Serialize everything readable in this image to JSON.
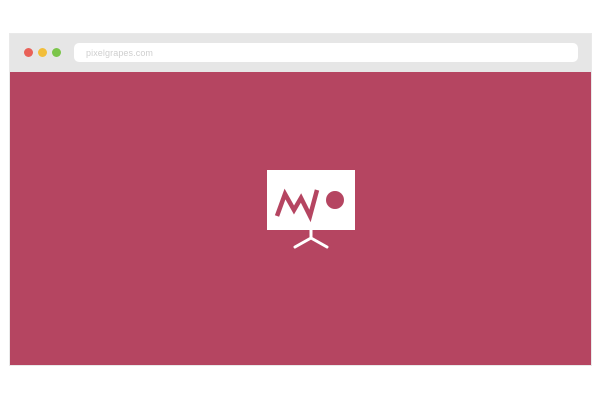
{
  "window": {
    "traffic_lights": [
      {
        "name": "close",
        "color": "#e96158"
      },
      {
        "name": "minimize",
        "color": "#f2be3a"
      },
      {
        "name": "maximize",
        "color": "#7bc54a"
      }
    ],
    "address_bar": {
      "url": "pixelgrapes.com"
    }
  },
  "colors": {
    "page_background": "#b54561",
    "titlebar": "#e6e6e6",
    "board": "#ffffff",
    "accent": "#b54561"
  },
  "content": {
    "icon": "presentation-board-icon"
  }
}
